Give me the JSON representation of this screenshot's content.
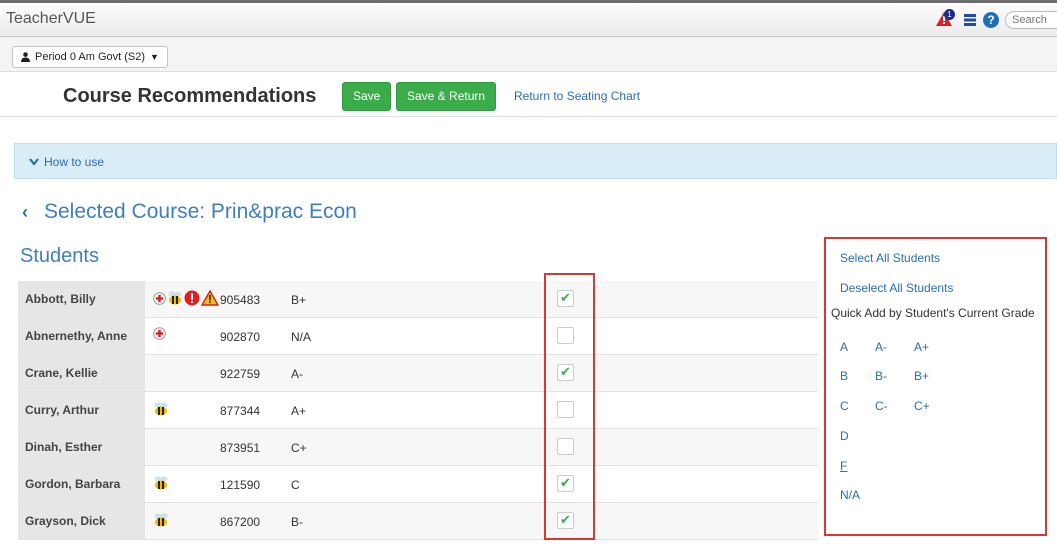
{
  "app": {
    "title": "TeacherVUE",
    "alert_count": "1",
    "help_label": "?",
    "search_placeholder": "Search"
  },
  "period": {
    "selected": "Period 0 Am Govt (S2)"
  },
  "header": {
    "title": "Course Recommendations",
    "save_label": "Save",
    "save_return_label": "Save & Return",
    "return_link": "Return to Seating Chart"
  },
  "how_to_use": {
    "label": "How to use"
  },
  "course": {
    "title": "Selected Course: Prin&prac Econ"
  },
  "students": {
    "heading": "Students",
    "rows": [
      {
        "name": "Abbott, Billy",
        "id": "905483",
        "grade": "B+",
        "checked": true,
        "icons": [
          "medical-icon",
          "bee-icon",
          "alert-circle-icon",
          "warning-icon"
        ]
      },
      {
        "name": "Abnernethy, Anne",
        "id": "902870",
        "grade": "N/A",
        "checked": false,
        "icons": [
          "medical-icon"
        ]
      },
      {
        "name": "Crane, Kellie",
        "id": "922759",
        "grade": "A-",
        "checked": true,
        "icons": []
      },
      {
        "name": "Curry, Arthur",
        "id": "877344",
        "grade": "A+",
        "checked": false,
        "icons": [
          "bee-icon"
        ]
      },
      {
        "name": "Dinah, Esther",
        "id": "873951",
        "grade": "C+",
        "checked": false,
        "icons": []
      },
      {
        "name": "Gordon, Barbara",
        "id": "121590",
        "grade": "C",
        "checked": true,
        "icons": [
          "bee-icon"
        ]
      },
      {
        "name": "Grayson, Dick",
        "id": "867200",
        "grade": "B-",
        "checked": true,
        "icons": [
          "bee-icon"
        ]
      }
    ]
  },
  "side_panel": {
    "select_all": "Select All Students",
    "deselect_all": "Deselect All Students",
    "quick_add_label": "Quick Add by Student's Current Grade",
    "grades": {
      "a": "A",
      "a_minus": "A-",
      "a_plus": "A+",
      "b": "B",
      "b_minus": "B-",
      "b_plus": "B+",
      "c": "C",
      "c_minus": "C-",
      "c_plus": "C+",
      "d": "D",
      "f": "F",
      "na": "N/A"
    }
  },
  "colors": {
    "accent_blue": "#3f7fbf",
    "link_blue": "#2a6db5",
    "save_green": "#3aac4a",
    "highlight_red": "#d93636"
  }
}
